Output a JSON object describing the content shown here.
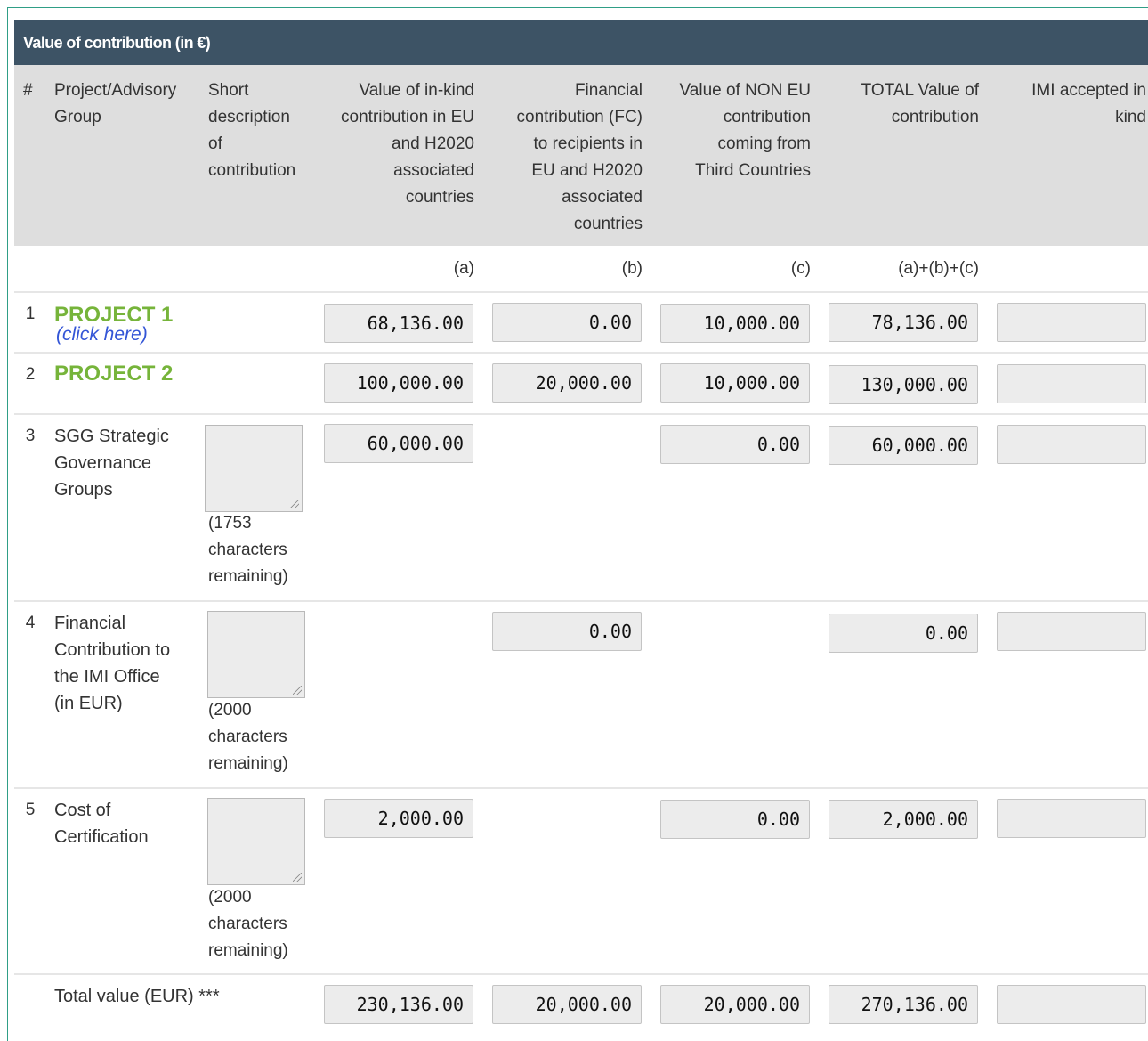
{
  "title": "Value of contribution (in €)",
  "headers": {
    "num": "#",
    "project": [
      "Project/Advisory",
      "Group"
    ],
    "short_desc": [
      "Short",
      "description",
      "of",
      "contribution"
    ],
    "inkind": [
      "Value of in-kind",
      "contribution in EU",
      "and H2020",
      "associated",
      "countries"
    ],
    "financial": [
      "Financial",
      "contribution (FC)",
      "to recipients in",
      "EU and H2020",
      "associated",
      "countries"
    ],
    "non_eu": [
      "Value of NON EU",
      "contribution",
      "coming from",
      "Third Countries"
    ],
    "total": [
      "TOTAL Value of",
      "contribution"
    ],
    "imi": [
      "IMI accepted in",
      "kind"
    ]
  },
  "column_labels": {
    "a": "(a)",
    "b": "(b)",
    "c": "(c)",
    "total": "(a)+(b)+(c)"
  },
  "rows": [
    {
      "num": "1",
      "name": "PROJECT 1",
      "link": "(click here)",
      "a": "68,136.00",
      "b": "0.00",
      "c": "10,000.00",
      "total": "78,136.00"
    },
    {
      "num": "2",
      "name": "PROJECT 2",
      "a": "100,000.00",
      "b": "20,000.00",
      "c": "10,000.00",
      "total": "130,000.00"
    },
    {
      "num": "3",
      "name": [
        "SGG Strategic",
        "Governance",
        "Groups"
      ],
      "remaining": [
        "(1753",
        "characters",
        "remaining)"
      ],
      "a": "60,000.00",
      "c": "0.00",
      "total": "60,000.00"
    },
    {
      "num": "4",
      "name": [
        "Financial",
        "Contribution to",
        "the IMI Office",
        "(in EUR)"
      ],
      "remaining": [
        "(2000",
        "characters",
        "remaining)"
      ],
      "b": "0.00",
      "total": "0.00"
    },
    {
      "num": "5",
      "name": [
        "Cost of",
        "Certification"
      ],
      "remaining": [
        "(2000",
        "characters",
        "remaining)"
      ],
      "a": "2,000.00",
      "c": "0.00",
      "total": "2,000.00"
    }
  ],
  "totals": {
    "label": "Total value (EUR) ***",
    "a": "230,136.00",
    "b": "20,000.00",
    "c": "20,000.00",
    "total": "270,136.00"
  }
}
